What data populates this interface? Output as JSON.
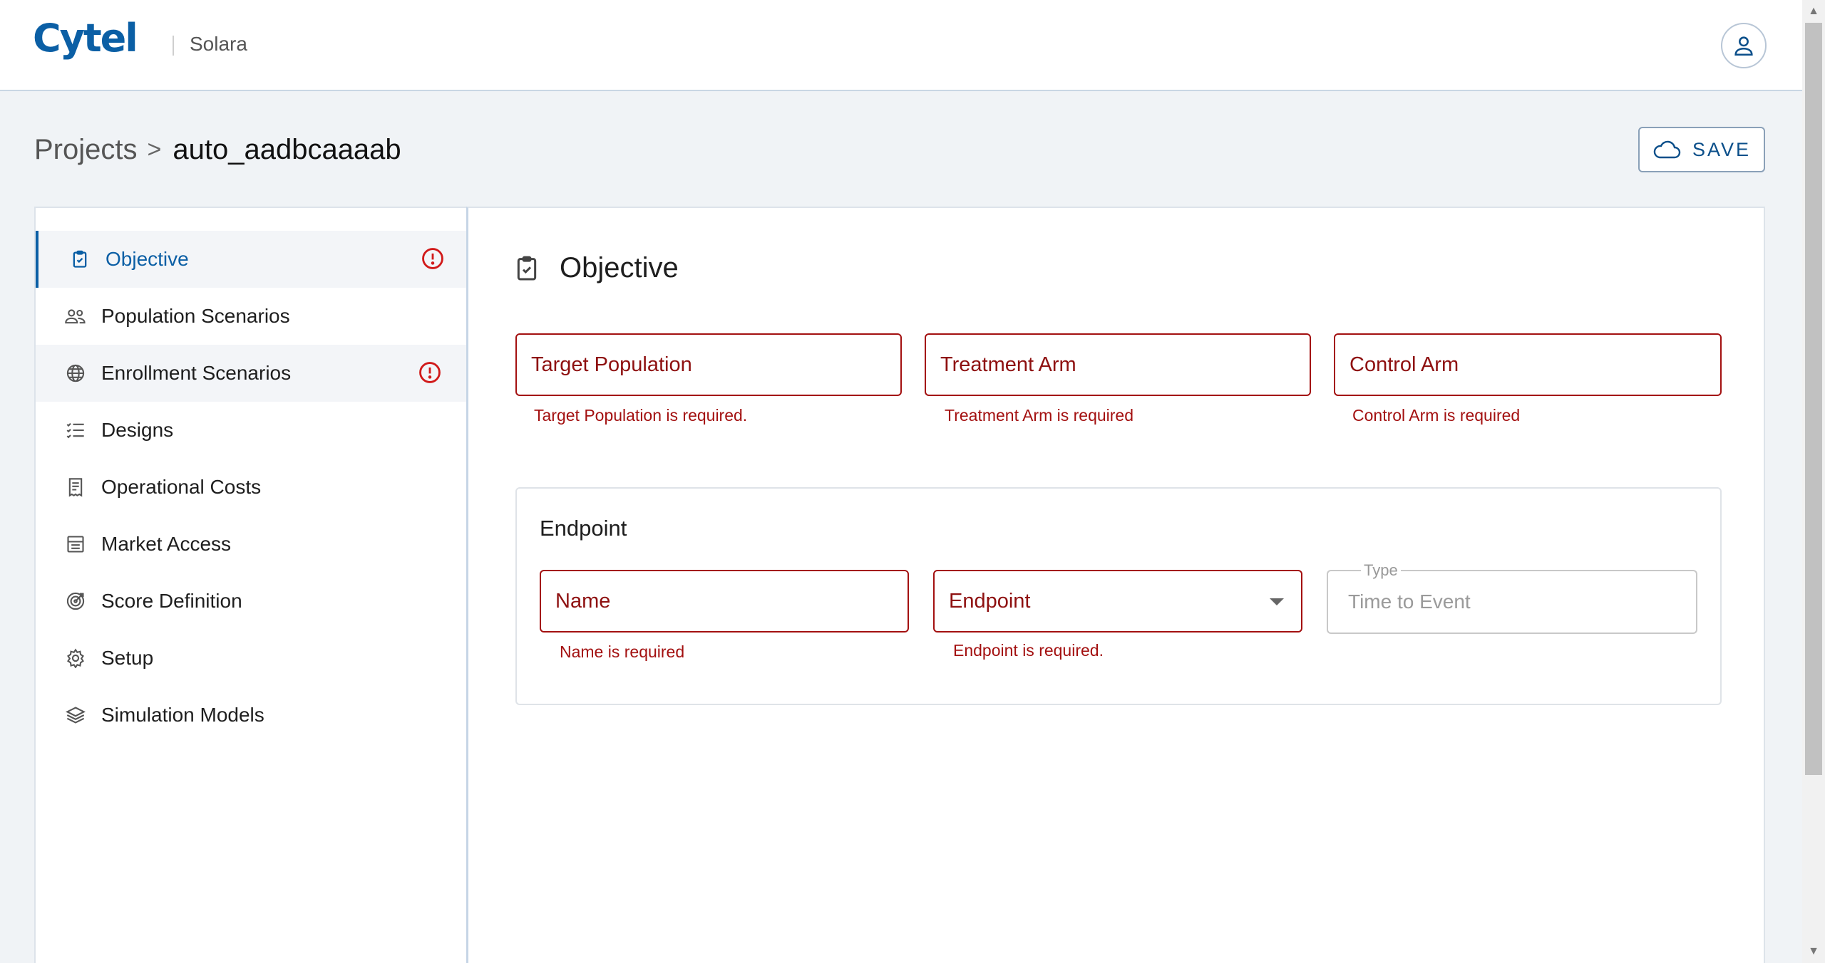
{
  "header": {
    "logo": "Cytel",
    "app_name": "Solara"
  },
  "breadcrumb": {
    "root": "Projects",
    "separator": ">",
    "current": "auto_aadbcaaaab"
  },
  "toolbar": {
    "save_label": "SAVE"
  },
  "sidebar": {
    "items": [
      {
        "label": "Objective",
        "icon": "clipboard-check-icon",
        "active": true,
        "error": true
      },
      {
        "label": "Population Scenarios",
        "icon": "users-icon",
        "active": false,
        "error": false
      },
      {
        "label": "Enrollment Scenarios",
        "icon": "globe-icon",
        "active": false,
        "error": true
      },
      {
        "label": "Designs",
        "icon": "checklist-icon",
        "active": false,
        "error": false
      },
      {
        "label": "Operational Costs",
        "icon": "receipt-icon",
        "active": false,
        "error": false
      },
      {
        "label": "Market Access",
        "icon": "storefront-icon",
        "active": false,
        "error": false
      },
      {
        "label": "Score Definition",
        "icon": "target-icon",
        "active": false,
        "error": false
      },
      {
        "label": "Setup",
        "icon": "gear-icon",
        "active": false,
        "error": false
      },
      {
        "label": "Simulation Models",
        "icon": "layers-icon",
        "active": false,
        "error": false
      }
    ]
  },
  "main": {
    "title": "Objective",
    "fields": {
      "target_population": {
        "placeholder": "Target Population",
        "error": "Target Population is required."
      },
      "treatment_arm": {
        "placeholder": "Treatment Arm",
        "error": "Treatment Arm is required"
      },
      "control_arm": {
        "placeholder": "Control Arm",
        "error": "Control Arm is required"
      }
    },
    "endpoint": {
      "heading": "Endpoint",
      "name": {
        "placeholder": "Name",
        "error": "Name is required"
      },
      "endpoint_select": {
        "placeholder": "Endpoint",
        "error": "Endpoint is required."
      },
      "type": {
        "label": "Type",
        "value": "Time to Event"
      }
    }
  },
  "colors": {
    "accent": "#0b5fa5",
    "error": "#a31010",
    "background": "#f0f3f6"
  }
}
